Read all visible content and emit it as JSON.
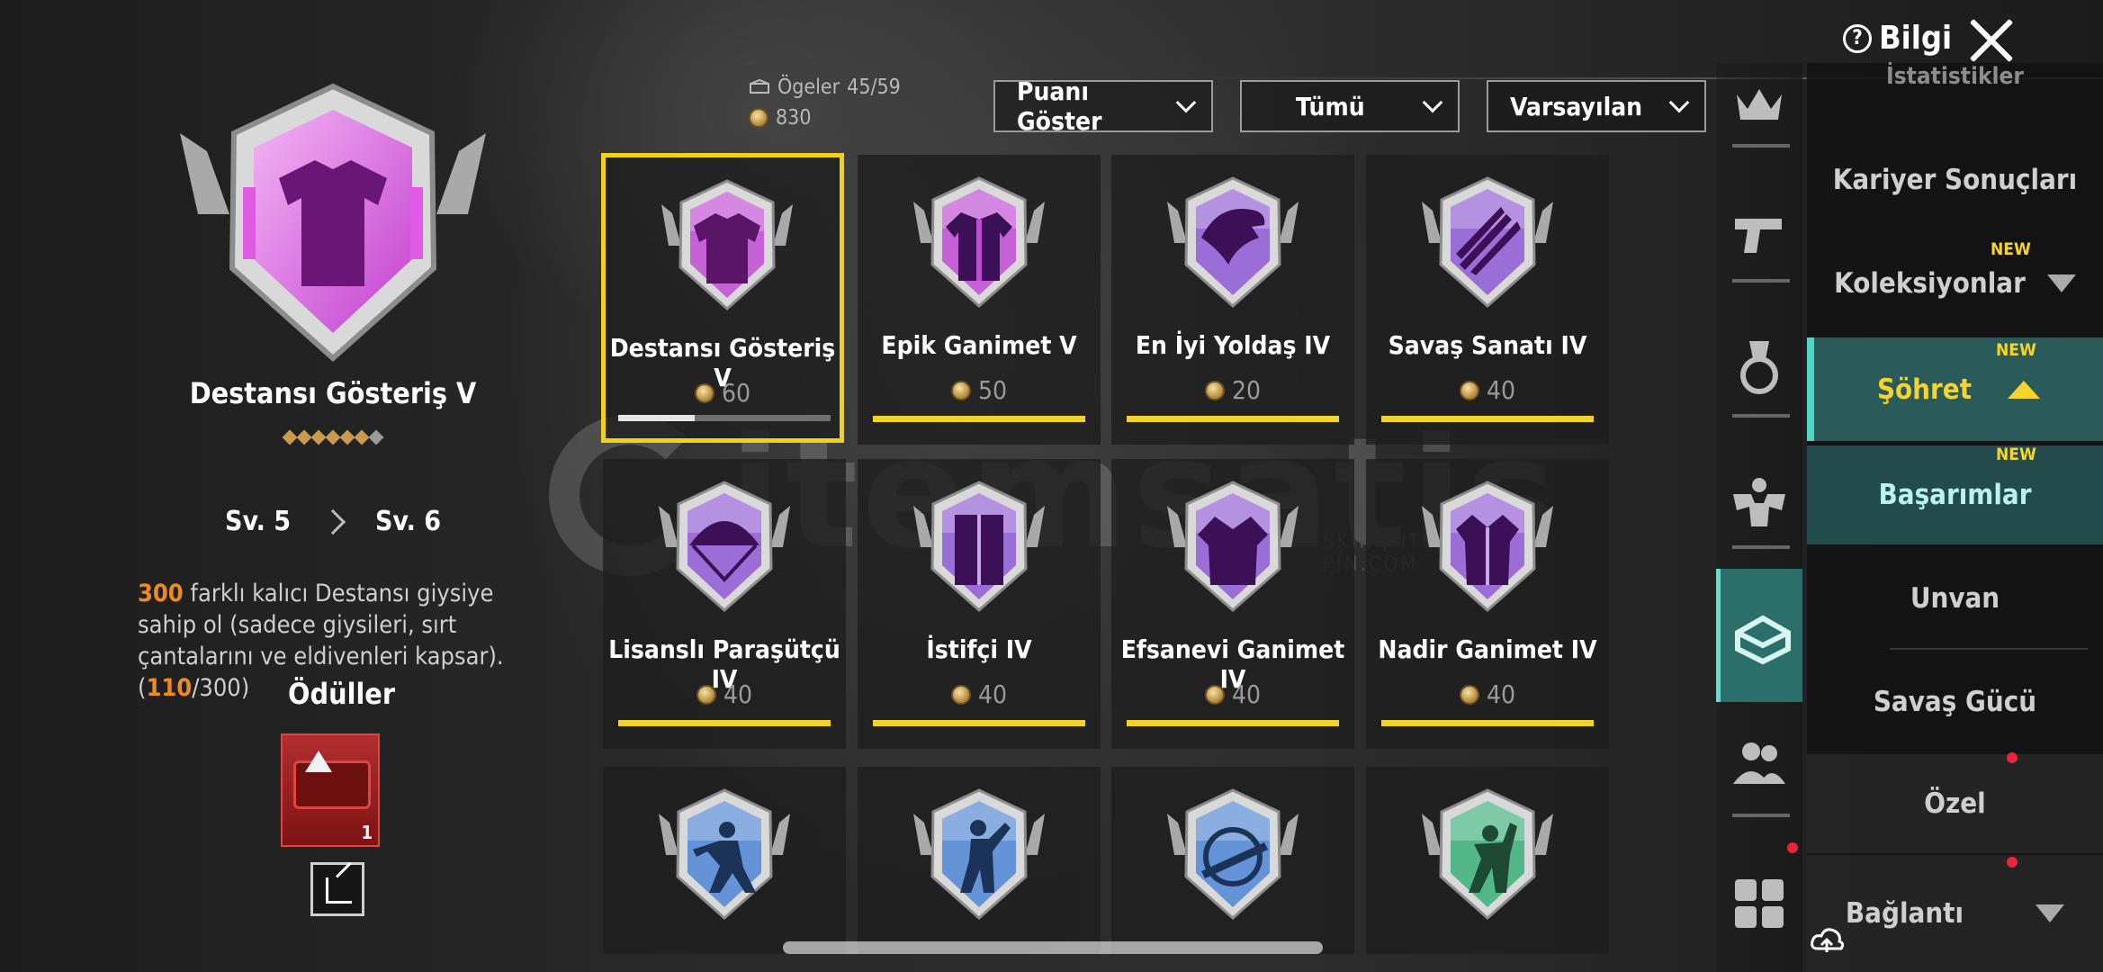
{
  "header": {
    "info_label": "Bilgi"
  },
  "detail": {
    "title": "Destansı Gösteriş V",
    "level_current": "Sv. 5",
    "level_next": "Sv. 6",
    "desc_highlight": "300",
    "desc_text": " farklı kalıcı Destansı giysiye sahip ol (sadece giysileri, sırt çantalarını ve eldivenleri kapsar). (",
    "desc_progress": "110",
    "desc_total": "/300)",
    "rewards_title": "Ödüller",
    "reward_qty": "1",
    "stars_filled": 6,
    "stars_total": 7
  },
  "counters": {
    "items_label": "Ögeler",
    "items_value": "45/59",
    "points_value": "830"
  },
  "filters": [
    "Puanı Göster",
    "Tümü",
    "Varsayılan"
  ],
  "grid": [
    {
      "name": "Destansı Gösteriş V",
      "points": "60",
      "icon": "jacket-icon",
      "color": "#c24bd6",
      "progress": 0.36
    },
    {
      "name": "Epik Ganimet V",
      "points": "50",
      "icon": "shirt-icon",
      "color": "#c24bd6"
    },
    {
      "name": "En İyi Yoldaş IV",
      "points": "20",
      "icon": "eagle-icon",
      "color": "#8f5ad6"
    },
    {
      "name": "Savaş Sanatı IV",
      "points": "40",
      "icon": "claw-marks-icon",
      "color": "#8f5ad6"
    },
    {
      "name": "Lisanslı Paraşütçü IV",
      "points": "40",
      "icon": "parachute-icon",
      "color": "#8f5ad6"
    },
    {
      "name": "İstifçi IV",
      "points": "40",
      "icon": "wardrobe-icon",
      "color": "#8f5ad6"
    },
    {
      "name": "Efsanevi Ganimet IV",
      "points": "40",
      "icon": "robe-icon",
      "color": "#8f5ad6"
    },
    {
      "name": "Nadir Ganimet IV",
      "points": "40",
      "icon": "coat-icon",
      "color": "#8f5ad6"
    },
    {
      "name": "",
      "points": "",
      "icon": "fighter-icon",
      "color": "#4f86d6"
    },
    {
      "name": "",
      "points": "",
      "icon": "dancer-icon",
      "color": "#4f86d6"
    },
    {
      "name": "",
      "points": "",
      "icon": "crosshair-rifle-icon",
      "color": "#4f86d6"
    },
    {
      "name": "",
      "points": "",
      "icon": "climber-icon",
      "color": "#3bb07a"
    }
  ],
  "menu": {
    "top_partial": "İstatistikler",
    "career": "Kariyer Sonuçları",
    "collections": "Koleksiyonlar",
    "fame": "Şöhret",
    "achievements": "Başarımlar",
    "title": "Unvan",
    "combat_power": "Savaş Gücü",
    "special": "Özel",
    "connection": "Bağlantı",
    "new_label": "NEW"
  },
  "watermark": {
    "brand": "itemsatis",
    "sub": "SKIN / ITEM / E-PIN.COM"
  },
  "colors": {
    "accent": "#f2d22b",
    "teal": "#2a5a5a",
    "highlight": "#f08a1d"
  }
}
